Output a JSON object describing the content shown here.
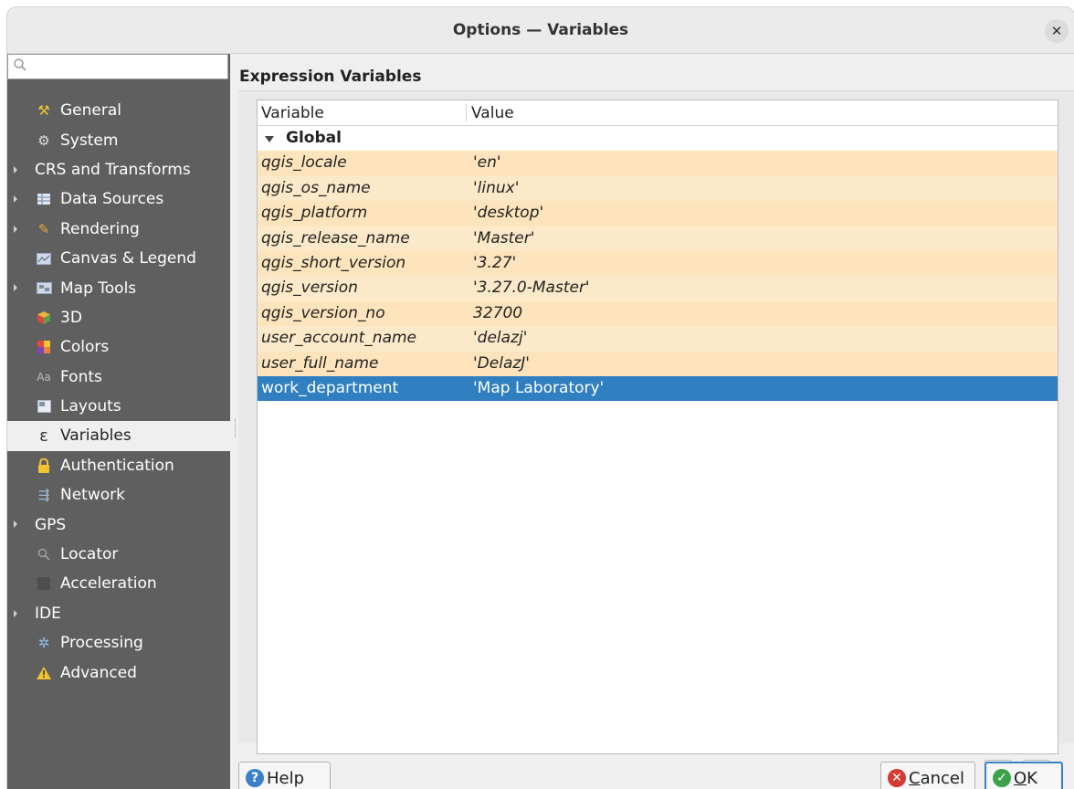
{
  "window": {
    "title": "Options — Variables"
  },
  "sidebar": {
    "search_placeholder": "",
    "items": [
      {
        "label": "General",
        "icon": "general-icon",
        "expandable": false,
        "selected": false
      },
      {
        "label": "System",
        "icon": "system-icon",
        "expandable": false,
        "selected": false
      },
      {
        "label": "CRS and Transforms",
        "icon": "",
        "expandable": true,
        "selected": false
      },
      {
        "label": "Data Sources",
        "icon": "data-sources-icon",
        "expandable": true,
        "selected": false
      },
      {
        "label": "Rendering",
        "icon": "rendering-icon",
        "expandable": true,
        "selected": false
      },
      {
        "label": "Canvas & Legend",
        "icon": "canvas-legend-icon",
        "expandable": false,
        "selected": false
      },
      {
        "label": "Map Tools",
        "icon": "map-tools-icon",
        "expandable": true,
        "selected": false
      },
      {
        "label": "3D",
        "icon": "3d-icon",
        "expandable": false,
        "selected": false
      },
      {
        "label": "Colors",
        "icon": "colors-icon",
        "expandable": false,
        "selected": false
      },
      {
        "label": "Fonts",
        "icon": "fonts-icon",
        "expandable": false,
        "selected": false
      },
      {
        "label": "Layouts",
        "icon": "layouts-icon",
        "expandable": false,
        "selected": false
      },
      {
        "label": "Variables",
        "icon": "variables-icon",
        "expandable": false,
        "selected": true
      },
      {
        "label": "Authentication",
        "icon": "lock-icon",
        "expandable": false,
        "selected": false
      },
      {
        "label": "Network",
        "icon": "network-icon",
        "expandable": false,
        "selected": false
      },
      {
        "label": "GPS",
        "icon": "",
        "expandable": true,
        "selected": false
      },
      {
        "label": "Locator",
        "icon": "locator-icon",
        "expandable": false,
        "selected": false
      },
      {
        "label": "Acceleration",
        "icon": "acceleration-icon",
        "expandable": false,
        "selected": false
      },
      {
        "label": "IDE",
        "icon": "",
        "expandable": true,
        "selected": false
      },
      {
        "label": "Processing",
        "icon": "processing-icon",
        "expandable": false,
        "selected": false
      },
      {
        "label": "Advanced",
        "icon": "warning-icon",
        "expandable": false,
        "selected": false
      }
    ]
  },
  "main": {
    "section_title": "Expression Variables",
    "table": {
      "columns": [
        "Variable",
        "Value"
      ],
      "group": "Global",
      "rows": [
        {
          "variable": "qgis_locale",
          "value": "'en'"
        },
        {
          "variable": "qgis_os_name",
          "value": "'linux'"
        },
        {
          "variable": "qgis_platform",
          "value": "'desktop'"
        },
        {
          "variable": "qgis_release_name",
          "value": "'Master'"
        },
        {
          "variable": "qgis_short_version",
          "value": "'3.27'"
        },
        {
          "variable": "qgis_version",
          "value": "'3.27.0-Master'"
        },
        {
          "variable": "qgis_version_no",
          "value": "32700"
        },
        {
          "variable": "user_account_name",
          "value": "'delazj'"
        },
        {
          "variable": "user_full_name",
          "value": "'DelazJ'"
        },
        {
          "variable": "work_department",
          "value": "'Map Laboratory'"
        }
      ],
      "selected_row": "work_department"
    }
  },
  "buttons": {
    "help": "Help",
    "cancel_first": "C",
    "cancel_rest": "ancel",
    "ok_first": "O",
    "ok_rest": "K"
  },
  "colors": {
    "sidebar_bg": "#5f5f5f",
    "builtin_row": "#fde4bd",
    "selection": "#2f7fc1"
  }
}
